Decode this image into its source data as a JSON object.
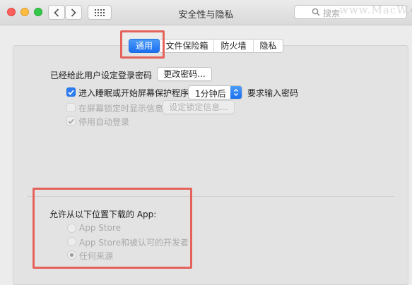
{
  "window": {
    "title": "安全性与隐私"
  },
  "search": {
    "placeholder": "搜索"
  },
  "watermark": "www.MacW.com",
  "tabs": [
    {
      "label": "通用",
      "active": true
    },
    {
      "label": "文件保险箱",
      "active": false
    },
    {
      "label": "防火墙",
      "active": false
    },
    {
      "label": "隐私",
      "active": false
    }
  ],
  "general": {
    "password_set_label": "已经给此用户设定登录密码",
    "change_password_button": "更改密码...",
    "require_password": {
      "prefix_label": "进入睡眠或开始屏幕保护程序",
      "checked": true,
      "delay_value": "1分钟后",
      "suffix_label": "要求输入密码"
    },
    "show_message": {
      "label": "在屏幕锁定时显示信息",
      "checked": false,
      "button": "设定锁定信息..."
    },
    "disable_auto_login": {
      "label": "停用自动登录",
      "checked": true
    }
  },
  "downloads": {
    "heading": "允许从以下位置下载的 App:",
    "options": [
      {
        "label": "App Store",
        "selected": false
      },
      {
        "label": "App Store和被认可的开发者",
        "selected": false
      },
      {
        "label": "任何来源",
        "selected": true
      }
    ]
  },
  "colors": {
    "accent": "#2d7cf4",
    "highlight_box": "#e5625a"
  }
}
